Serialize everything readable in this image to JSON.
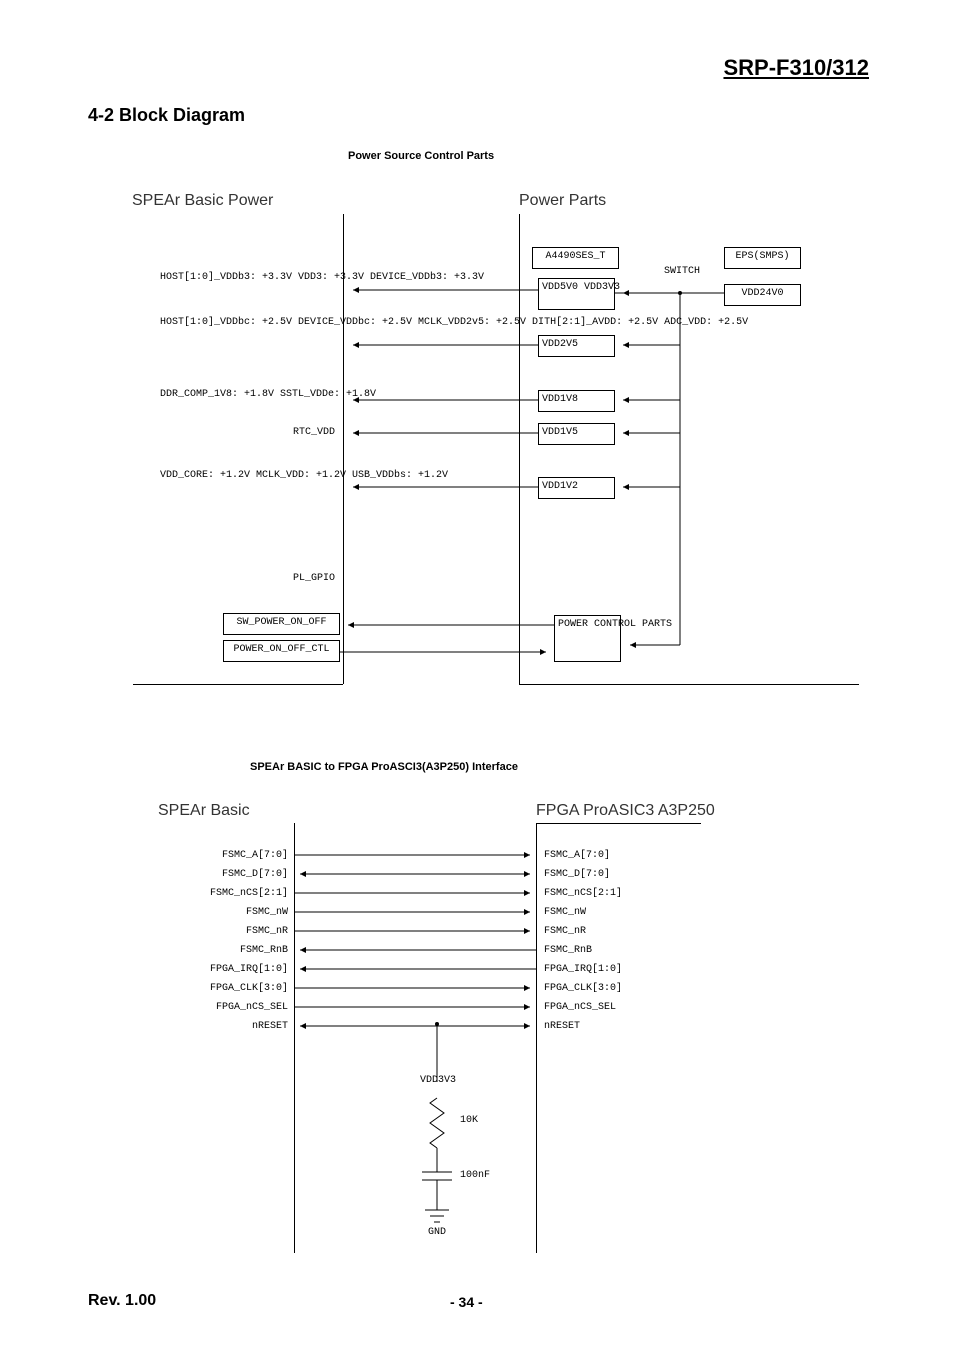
{
  "header": "SRP-F310/312",
  "section_title": "4-2 Block Diagram",
  "figure1_title": "Power Source Control Parts",
  "figure2_title": "SPEAr BASIC to FPGA ProASCI3(A3P250) Interface",
  "blocks": {
    "spear_power": "SPEAr Basic Power",
    "power_parts": "Power Parts",
    "spear_basic": "SPEAr Basic",
    "fpga": "FPGA ProASIC3 A3P250"
  },
  "spear_power_labels": {
    "g33": "HOST[1:0]_VDDb3: +3.3V\nVDD3: +3.3V\nDEVICE_VDDb3: +3.3V",
    "g25": "HOST[1:0]_VDDbc: +2.5V\nDEVICE_VDDbc: +2.5V\nMCLK_VDD2v5: +2.5V\nDITH[2:1]_AVDD: +2.5V\nADC_VDD: +2.5V",
    "g18": "DDR_COMP_1V8: +1.8V\nSSTL_VDDe: +1.8V",
    "rtc": "RTC_VDD",
    "g12": "VDD_CORE: +1.2V\nMCLK_VDD: +1.2V\nUSB_VDDbs: +1.2V",
    "plgpio": "PL_GPIO",
    "sw_power": "SW_POWER_ON_OFF",
    "power_ctl": "POWER_ON_OFF_CTL"
  },
  "power_parts_labels": {
    "a4490": "A4490SES_T",
    "vdd5v0": "VDD5V0\nVDD3V3",
    "vdd2v5": "VDD2V5",
    "vdd1v8": "VDD1V8",
    "vdd1v5": "VDD1V5",
    "vdd1v2": "VDD1V2",
    "power_control": "POWER\nCONTROL\nPARTS",
    "switch": "SWITCH",
    "eps": "EPS(SMPS)",
    "vdd24v0": "VDD24V0"
  },
  "interface_signals": [
    "FSMC_A[7:0]",
    "FSMC_D[7:0]",
    "FSMC_nCS[2:1]",
    "FSMC_nW",
    "FSMC_nR",
    "FSMC_RnB",
    "FPGA_IRQ[1:0]",
    "FPGA_CLK[3:0]",
    "FPGA_nCS_SEL",
    "nRESET"
  ],
  "reset_circuit": {
    "vdd": "VDD3V3",
    "r": "10K",
    "c": "100nF",
    "gnd": "GND"
  },
  "footer": {
    "rev": "Rev. 1.00",
    "page": "- 34 -"
  }
}
